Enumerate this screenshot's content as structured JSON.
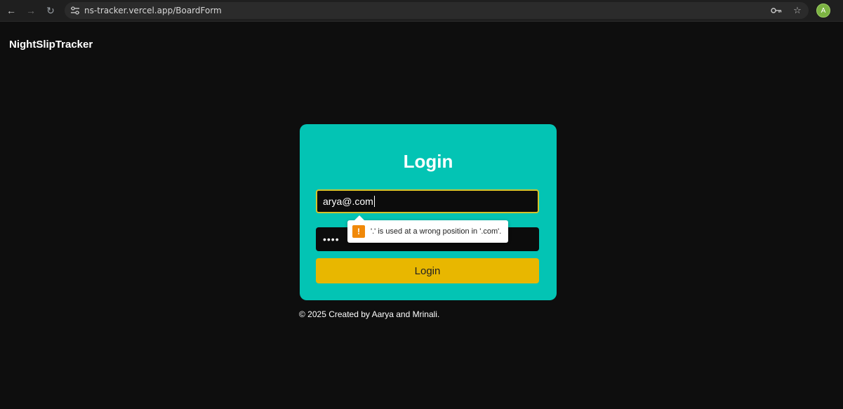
{
  "browser": {
    "url": "ns-tracker.vercel.app/BoardForm",
    "avatar_initial": "A"
  },
  "app": {
    "brand": "NightSlipTracker"
  },
  "login": {
    "title": "Login",
    "email_value": "arya@.com",
    "password_mask": "••••",
    "button_label": "Login",
    "validation_message": "'.' is used at a wrong position in '.com'."
  },
  "footer": {
    "text": "© 2025 Created by Aarya and Mrinali."
  },
  "colors": {
    "background": "#0e0e0e",
    "card": "#03c4b4",
    "button": "#e8b700",
    "focus_border": "#d4c22a",
    "warning": "#f0890a"
  }
}
